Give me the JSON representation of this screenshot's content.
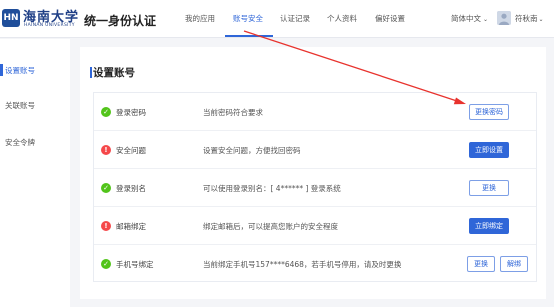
{
  "header": {
    "logo_cn": "海南大学",
    "logo_en": "HAINAN UNIVERSITY",
    "logo_seal": "HN",
    "app_title": "统一身份认证",
    "nav": [
      {
        "label": "我的应用"
      },
      {
        "label": "账号安全"
      },
      {
        "label": "认证记录"
      },
      {
        "label": "个人资料"
      },
      {
        "label": "偏好设置"
      }
    ],
    "active_nav": "账号安全",
    "language": "简体中文",
    "user_name": "符秋南"
  },
  "sidebar": {
    "items": [
      {
        "label": "设置账号"
      },
      {
        "label": "关联账号"
      },
      {
        "label": "安全令牌"
      }
    ],
    "active": "设置账号"
  },
  "main": {
    "title": "设置账号",
    "rows": [
      {
        "status": "ok",
        "label": "登录密码",
        "desc": "当前密码符合要求",
        "buttons": [
          {
            "label": "更换密码",
            "style": "outline"
          }
        ]
      },
      {
        "status": "warn",
        "label": "安全问题",
        "desc": "设置安全问题，方便找回密码",
        "buttons": [
          {
            "label": "立即设置",
            "style": "primary"
          }
        ]
      },
      {
        "status": "ok",
        "label": "登录别名",
        "desc": "可以使用登录别名：[ 4****** ] 登录系统",
        "buttons": [
          {
            "label": "更换",
            "style": "outline"
          }
        ]
      },
      {
        "status": "warn",
        "label": "邮箱绑定",
        "desc": "绑定邮箱后，可以提高您账户的安全程度",
        "buttons": [
          {
            "label": "立即绑定",
            "style": "primary"
          }
        ]
      },
      {
        "status": "ok",
        "label": "手机号绑定",
        "desc": "当前绑定手机号157****6468，若手机号停用，请及时更换",
        "buttons": [
          {
            "label": "更换",
            "style": "outline"
          },
          {
            "label": "解绑",
            "style": "outline"
          }
        ]
      }
    ]
  },
  "colors": {
    "accent": "#2f66d8",
    "ok": "#52c41a",
    "warn": "#f5484a",
    "annotation_arrow": "#e8332e"
  },
  "icons": {
    "ok": "check-circle-icon",
    "warn": "exclamation-circle-icon",
    "lang_dropdown": "chevron-down-icon",
    "user_dropdown": "chevron-down-icon"
  }
}
